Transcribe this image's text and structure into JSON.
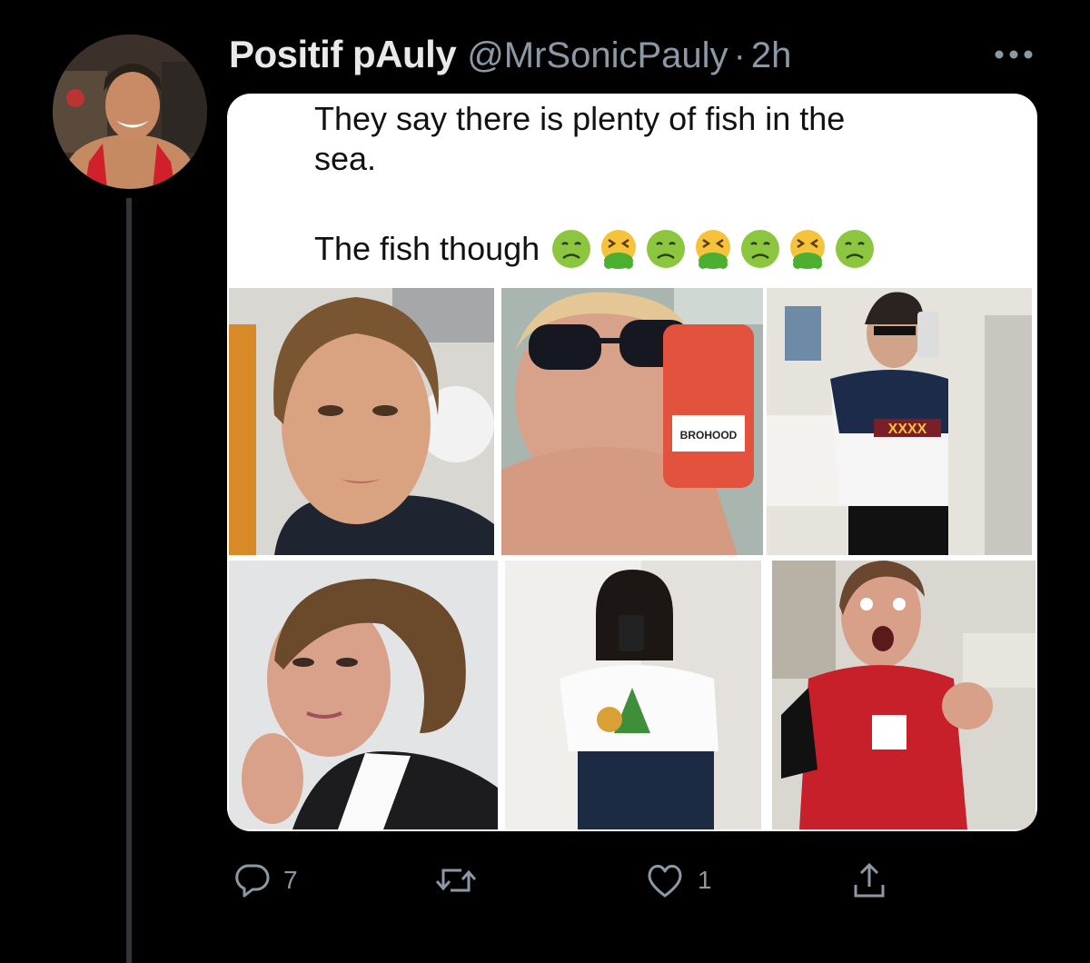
{
  "tweet": {
    "display_name": "Positif pAuly",
    "handle": "@MrSonicPauly",
    "separator": "·",
    "time": "2h",
    "meme": {
      "line1": "They say there is plenty of fish in the",
      "line2": "sea.",
      "line3": "The fish though",
      "emojis": [
        "nauseated-face",
        "vomiting-face",
        "nauseated-face",
        "vomiting-face",
        "nauseated-face",
        "vomiting-face",
        "nauseated-face"
      ]
    },
    "photos": [
      {
        "name": "photo-woman-nose-ring"
      },
      {
        "name": "photo-woman-sunglasses-can"
      },
      {
        "name": "photo-woman-jersey-selfie"
      },
      {
        "name": "photo-woman-braided-hair"
      },
      {
        "name": "photo-woman-christmas-shirt-selfie"
      },
      {
        "name": "photo-woman-red-jersey"
      }
    ],
    "can_text": "BROHOOD",
    "jersey_text": "XXXX"
  },
  "actions": {
    "reply_count": "7",
    "retweet_count": "",
    "like_count": "1"
  },
  "colors": {
    "background": "#000000",
    "secondary_text": "#8b98a5",
    "thread_line": "#333639"
  }
}
